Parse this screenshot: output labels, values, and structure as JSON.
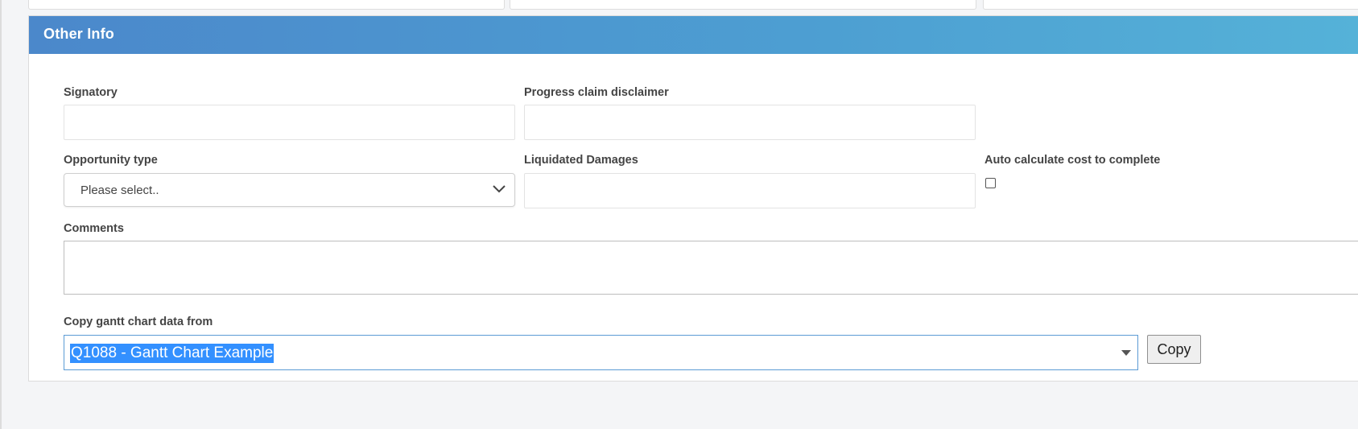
{
  "panel": {
    "title": "Other Info"
  },
  "fields": {
    "signatory": {
      "label": "Signatory",
      "value": ""
    },
    "progress_claim_disclaimer": {
      "label": "Progress claim disclaimer",
      "value": ""
    },
    "opportunity_type": {
      "label": "Opportunity type",
      "value": "Please select.."
    },
    "liquidated_damages": {
      "label": "Liquidated Damages",
      "value": ""
    },
    "auto_calc": {
      "label": "Auto calculate cost to complete",
      "checked": false
    },
    "comments": {
      "label": "Comments",
      "value": ""
    },
    "copy_gantt": {
      "label": "Copy gantt chart data from",
      "value": "Q1088 - Gantt Chart Example",
      "button_label": "Copy"
    }
  },
  "icons": {
    "select_chevron": "chevron-down-icon",
    "combo_arrow": "caret-down-icon"
  },
  "colors": {
    "header_start": "#4b88cb",
    "header_end": "#55b2d8",
    "selection": "#3390ff",
    "combo_border": "#5b9bd5"
  }
}
